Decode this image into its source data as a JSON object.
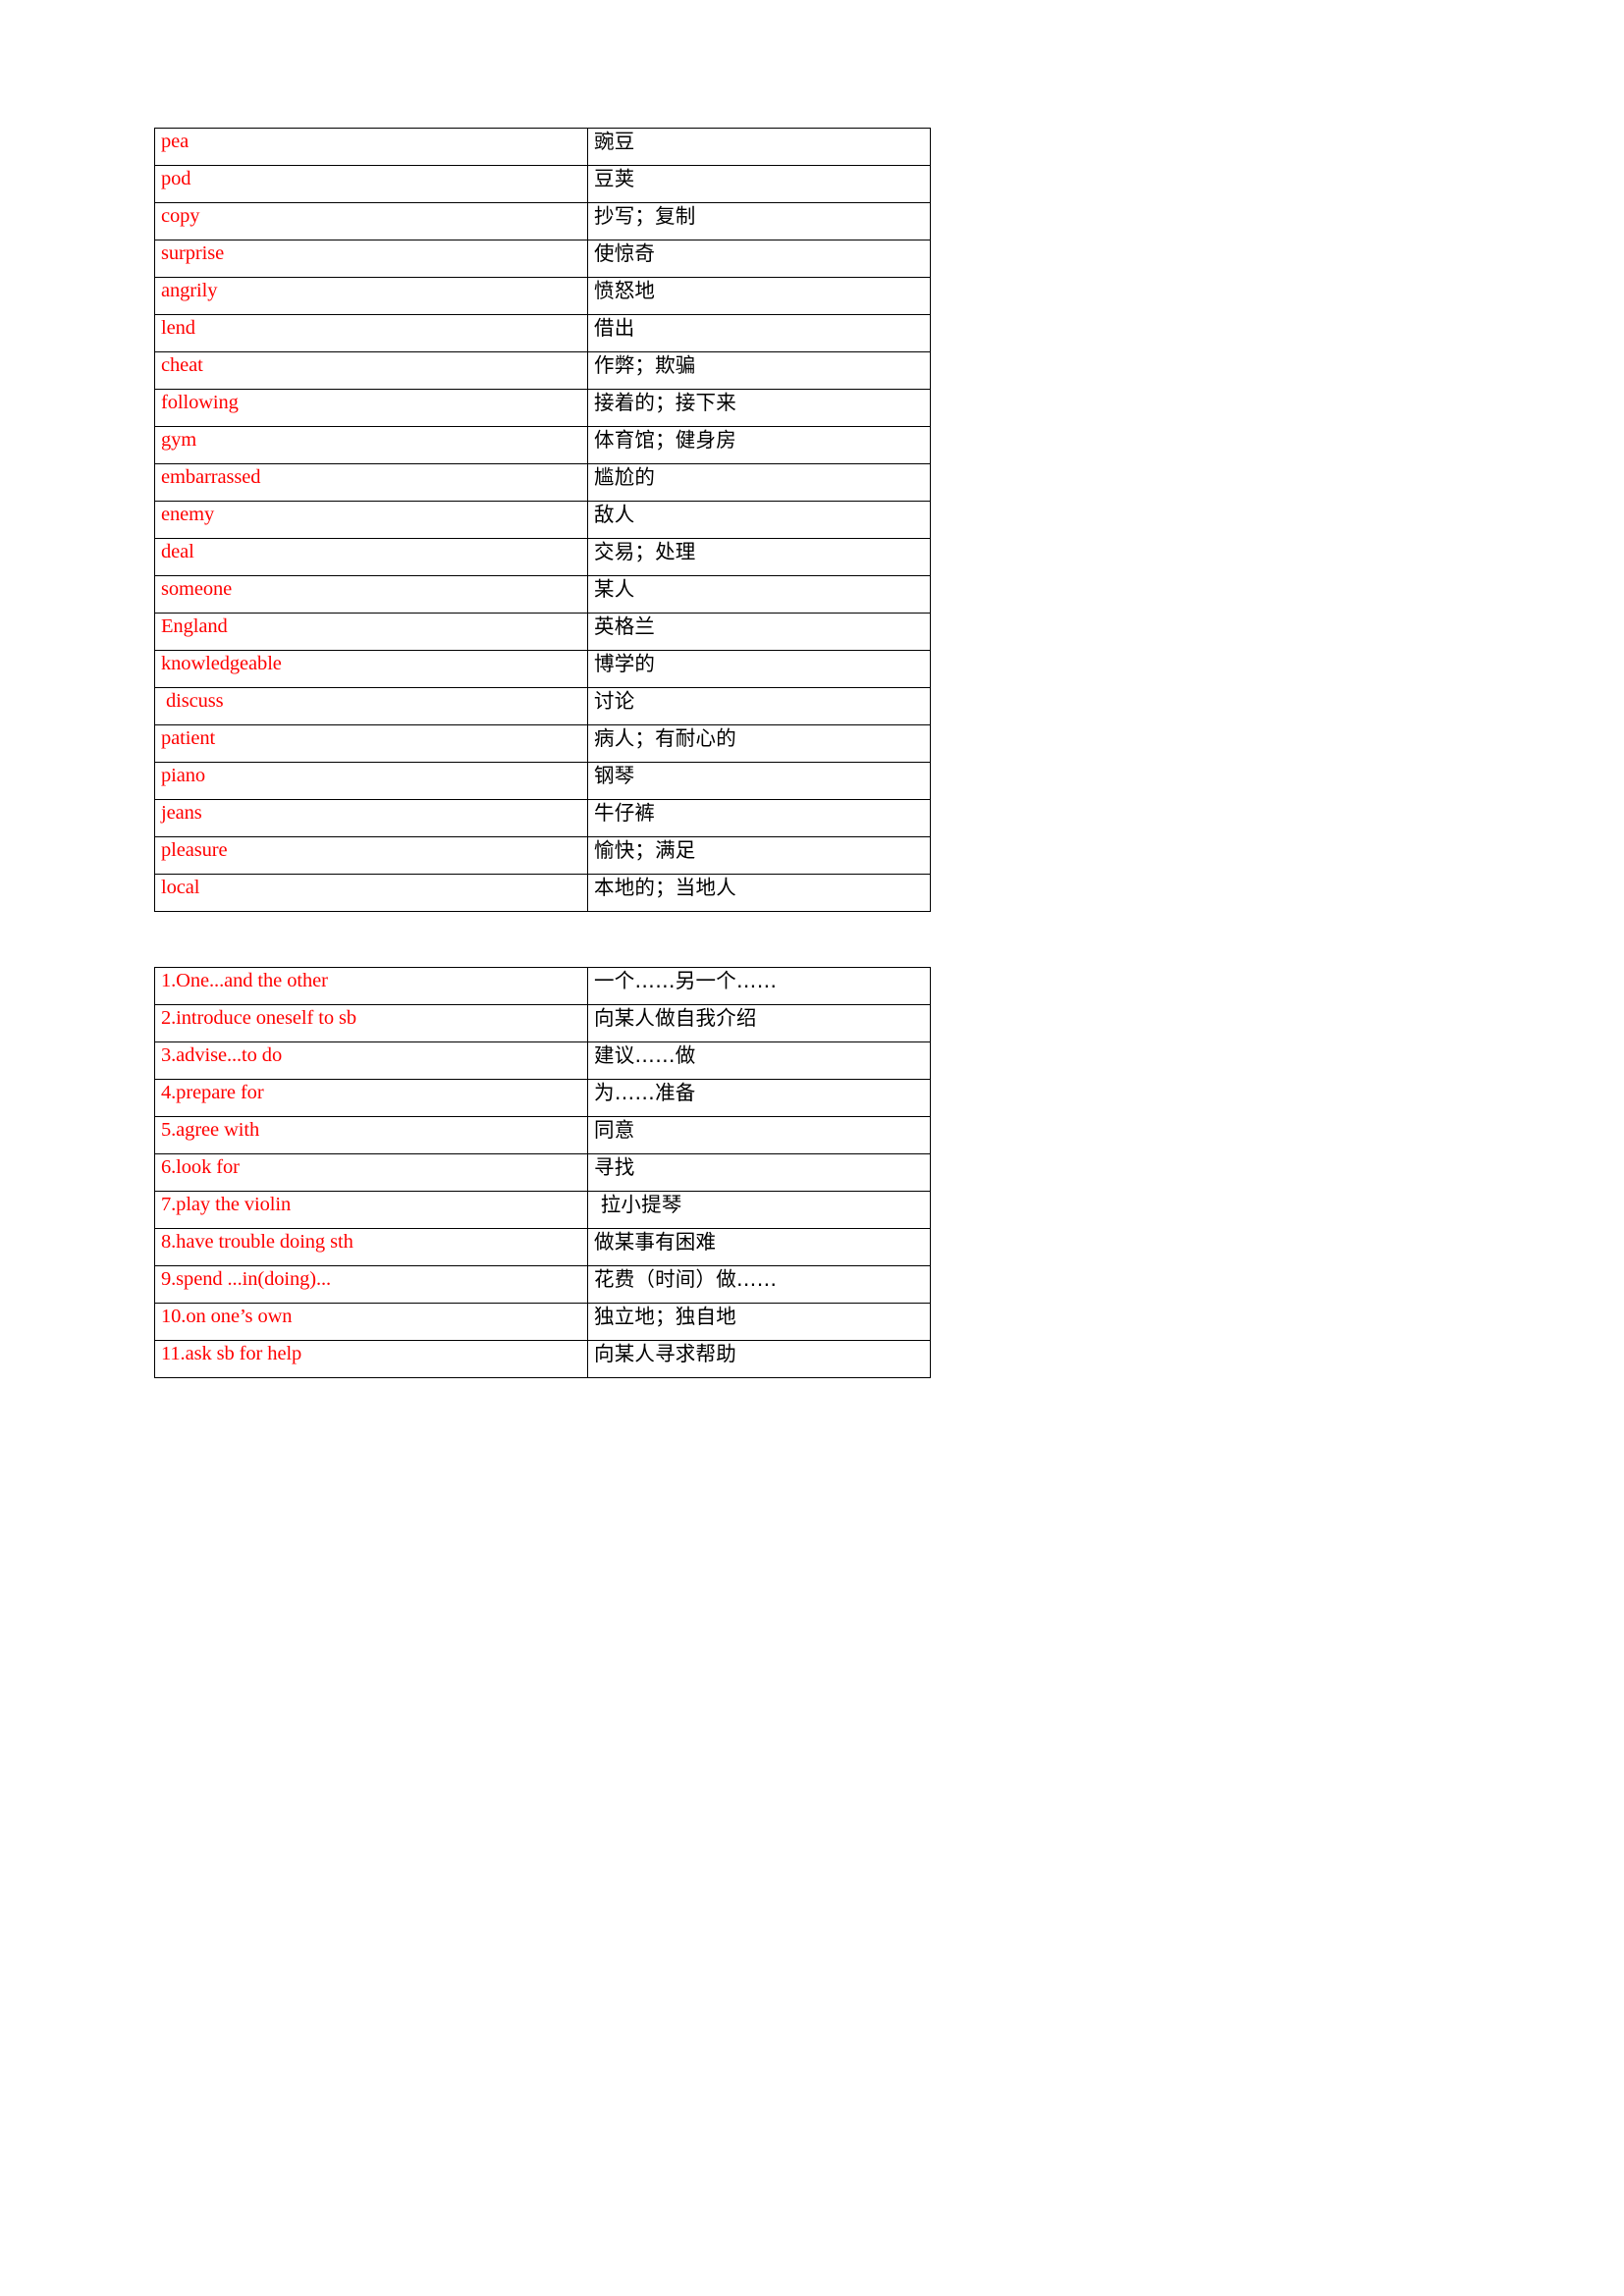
{
  "document": {
    "kind": "vocabulary-worksheet",
    "colors": {
      "english_text": "#ff0000",
      "chinese_text": "#000000",
      "border": "#000000",
      "page_background": "#ffffff"
    }
  },
  "vocab_table": {
    "name": "word-list-table",
    "rows": [
      {
        "en": "pea",
        "zh": "豌豆"
      },
      {
        "en": "pod",
        "zh": "豆荚"
      },
      {
        "en": "copy",
        "zh": "抄写；复制"
      },
      {
        "en": "surprise",
        "zh": "使惊奇"
      },
      {
        "en": "angrily",
        "zh": "愤怒地"
      },
      {
        "en": "lend",
        "zh": "借出"
      },
      {
        "en": "cheat",
        "zh": "作弊；欺骗"
      },
      {
        "en": "following",
        "zh": "接着的；接下来"
      },
      {
        "en": "gym",
        "zh": "体育馆；健身房"
      },
      {
        "en": "embarrassed",
        "zh": "尴尬的"
      },
      {
        "en": "enemy",
        "zh": "敌人"
      },
      {
        "en": "deal",
        "zh": "交易；处理"
      },
      {
        "en": "someone",
        "zh": "某人"
      },
      {
        "en": "England",
        "zh": "英格兰"
      },
      {
        "en": "knowledgeable",
        "zh": "博学的"
      },
      {
        "en": " discuss",
        "zh": "讨论"
      },
      {
        "en": "patient",
        "zh": "病人；有耐心的"
      },
      {
        "en": "piano",
        "zh": "钢琴"
      },
      {
        "en": "jeans",
        "zh": "牛仔裤"
      },
      {
        "en": "pleasure",
        "zh": "愉快；满足"
      },
      {
        "en": "local",
        "zh": "本地的；当地人"
      }
    ]
  },
  "phrase_table": {
    "name": "phrase-list-table",
    "rows": [
      {
        "en": "1.One...and the other",
        "zh": "一个……另一个……"
      },
      {
        "en": "2.introduce oneself to sb",
        "zh": "向某人做自我介绍"
      },
      {
        "en": "3.advise...to do",
        "zh": "建议……做"
      },
      {
        "en": "4.prepare for",
        "zh": "为……准备"
      },
      {
        "en": "5.agree with",
        "zh": "同意"
      },
      {
        "en": "6.look for",
        "zh": "寻找"
      },
      {
        "en": "7.play the violin",
        "zh": " 拉小提琴"
      },
      {
        "en": "8.have trouble doing sth",
        "zh": "做某事有困难"
      },
      {
        "en": "9.spend ...in(doing)...",
        "zh": "花费（时间）做……"
      },
      {
        "en": "10.on one’s own",
        "zh": "独立地；独自地"
      },
      {
        "en": "11.ask sb for help",
        "zh": "向某人寻求帮助"
      }
    ]
  }
}
